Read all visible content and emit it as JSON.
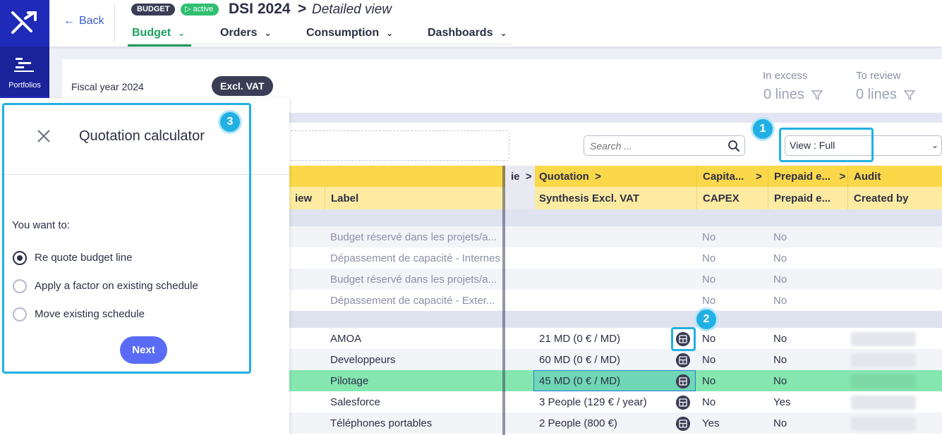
{
  "sidebar": {
    "portfolios_label": "Portfolios"
  },
  "header": {
    "back_label": "Back",
    "badge_budget": "BUDGET",
    "badge_active": "active",
    "title": "DSI 2024",
    "title_arrow": ">",
    "subtitle": "Detailed view",
    "tabs": [
      {
        "label": "Budget",
        "active": true
      },
      {
        "label": "Orders"
      },
      {
        "label": "Consumption"
      },
      {
        "label": "Dashboards"
      }
    ]
  },
  "toolbar": {
    "fiscal_year": "Fiscal year 2024",
    "vat_label": "Excl. VAT",
    "in_excess_label": "In excess",
    "in_excess_value": "0  lines",
    "to_review_label": "To review",
    "to_review_value": "0  lines",
    "search_placeholder": "Search ...",
    "view_select": "View : Full"
  },
  "callouts": [
    "1",
    "2",
    "3"
  ],
  "table": {
    "group_headers": [
      {
        "label": "ie",
        "arrow": ">"
      },
      {
        "label": "Quotation",
        "arrow": ">"
      },
      {
        "label": "Capita...",
        "arrow": ">"
      },
      {
        "label": "Prepaid e...",
        "arrow": ">"
      },
      {
        "label": "Audit"
      }
    ],
    "columns": [
      "iew",
      "Label",
      "Synthesis Excl. VAT",
      "CAPEX",
      "Prepaid e...",
      "Created by"
    ],
    "group1_rows": [
      {
        "label": "Budget réservé dans les projets/a...",
        "capex": "No",
        "prepaid": "No"
      },
      {
        "label": "Dépassement de capacité - Internes",
        "capex": "No",
        "prepaid": "No"
      },
      {
        "label": "Budget réservé dans les projets/a...",
        "capex": "No",
        "prepaid": "No"
      },
      {
        "label": "Dépassement de capacité - Exter...",
        "capex": "No",
        "prepaid": "No"
      }
    ],
    "group2_rows": [
      {
        "label": "AMOA",
        "synthesis": "21 MD (0 € / MD)",
        "capex": "No",
        "prepaid": "No"
      },
      {
        "label": "Developpeurs",
        "synthesis": "60 MD (0 € / MD)",
        "capex": "No",
        "prepaid": "No"
      },
      {
        "label": "Pilotage",
        "synthesis": "45 MD (0 € / MD)",
        "capex": "No",
        "prepaid": "No"
      },
      {
        "label": "Salesforce",
        "synthesis": "3 People (129 € / year)",
        "capex": "No",
        "prepaid": "Yes"
      },
      {
        "label": "Téléphones portables",
        "synthesis": "2 People (800 €)",
        "capex": "Yes",
        "prepaid": "No"
      }
    ]
  },
  "panel": {
    "title": "Quotation calculator",
    "question": "You want to:",
    "options": [
      {
        "label": "Re quote budget line",
        "checked": true
      },
      {
        "label": "Apply a factor on existing schedule"
      },
      {
        "label": "Move existing schedule"
      }
    ],
    "next_label": "Next"
  },
  "colors": {
    "sidebar": "#1f2ab8",
    "accent_green": "#1f9f61",
    "header_yellow": "#fbd74a",
    "callout_blue": "#21b0e3",
    "next_button": "#5a6bf5"
  }
}
